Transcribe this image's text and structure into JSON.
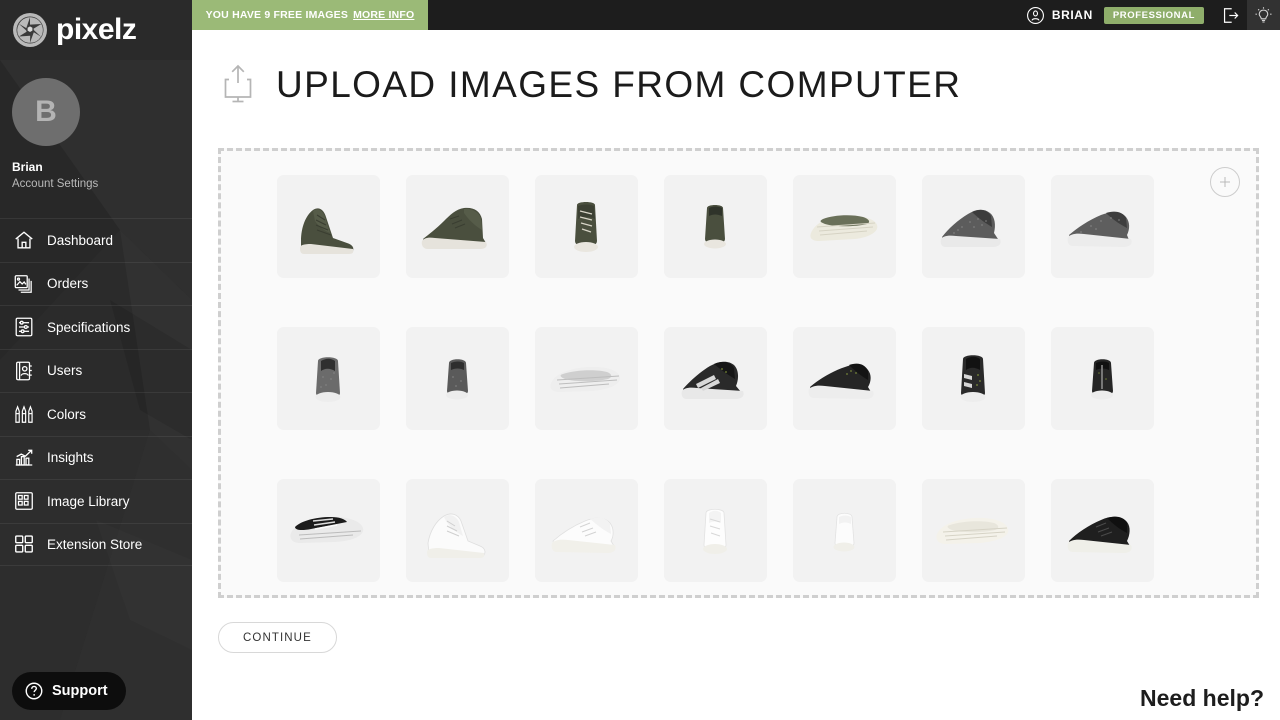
{
  "brand": {
    "logo_icon": "aperture-icon",
    "name": "pixelz"
  },
  "topbar": {
    "free_banner": {
      "text": "YOU HAVE 9 FREE IMAGES",
      "link_label": "MORE INFO",
      "background_color": "#9bba77"
    },
    "user": {
      "icon": "user-circle-icon",
      "name": "BRIAN",
      "plan_badge": "PROFESSIONAL",
      "plan_badge_color": "#8fae6b"
    },
    "logout_icon": "logout-icon",
    "tips_icon": "lightbulb-icon"
  },
  "sidebar": {
    "profile": {
      "avatar_initial": "B",
      "name": "Brian",
      "subtitle": "Account Settings"
    },
    "items": [
      {
        "label": "Dashboard",
        "icon": "home-icon"
      },
      {
        "label": "Orders",
        "icon": "images-stack-icon"
      },
      {
        "label": "Specifications",
        "icon": "sliders-document-icon"
      },
      {
        "label": "Users",
        "icon": "address-book-icon"
      },
      {
        "label": "Colors",
        "icon": "crayons-icon"
      },
      {
        "label": "Insights",
        "icon": "bar-chart-trend-icon"
      },
      {
        "label": "Image Library",
        "icon": "image-library-icon"
      },
      {
        "label": "Extension Store",
        "icon": "grid-squares-icon"
      }
    ],
    "support": {
      "label": "Support",
      "icon": "question-circle-icon"
    }
  },
  "main": {
    "page_icon": "upload-to-computer-icon",
    "page_title": "UPLOAD IMAGES FROM COMPUTER",
    "dropzone": {
      "add_button_icon": "plus-circle-icon",
      "border_style": "dashed",
      "border_color": "#cfcfcf",
      "thumbnail_count": 21,
      "thumbnails": [
        {
          "name": "olive-high-top-three-quarter-left",
          "alt": "Olive high-top sneaker, three-quarter left view"
        },
        {
          "name": "olive-high-top-side-left",
          "alt": "Olive high-top sneaker, side left view"
        },
        {
          "name": "olive-high-top-front",
          "alt": "Olive high-top sneaker, front view"
        },
        {
          "name": "olive-high-top-back",
          "alt": "Olive high-top sneaker, back view"
        },
        {
          "name": "olive-high-top-sole",
          "alt": "Olive high-top sneaker, sole view"
        },
        {
          "name": "grey-knit-runner-three-quarter",
          "alt": "Grey knit runner, three-quarter view"
        },
        {
          "name": "grey-knit-runner-side",
          "alt": "Grey knit runner, side view"
        },
        {
          "name": "grey-knit-runner-front",
          "alt": "Grey knit runner, front view"
        },
        {
          "name": "grey-knit-runner-back",
          "alt": "Grey knit runner, back view"
        },
        {
          "name": "grey-knit-runner-sole",
          "alt": "Grey knit runner, sole view"
        },
        {
          "name": "black-knit-runner-three-quarter",
          "alt": "Black knit runner, three-quarter view"
        },
        {
          "name": "black-knit-runner-side",
          "alt": "Black knit runner, side view"
        },
        {
          "name": "black-knit-runner-front",
          "alt": "Black knit runner, front view"
        },
        {
          "name": "black-knit-runner-back",
          "alt": "Black knit runner, back view"
        },
        {
          "name": "black-knit-runner-sole",
          "alt": "Black knit runner, sole view"
        },
        {
          "name": "white-sneaker-three-quarter",
          "alt": "White sneaker, three-quarter view"
        },
        {
          "name": "white-sneaker-side",
          "alt": "White sneaker, side view"
        },
        {
          "name": "white-sneaker-front",
          "alt": "White sneaker, front view"
        },
        {
          "name": "white-sneaker-back",
          "alt": "White sneaker, back view"
        },
        {
          "name": "white-sneaker-sole",
          "alt": "White sneaker, sole view"
        },
        {
          "name": "black-leather-sneaker-side",
          "alt": "Black leather sneaker, side view"
        }
      ]
    },
    "continue_label": "CONTINUE",
    "need_help_label": "Need help?"
  }
}
